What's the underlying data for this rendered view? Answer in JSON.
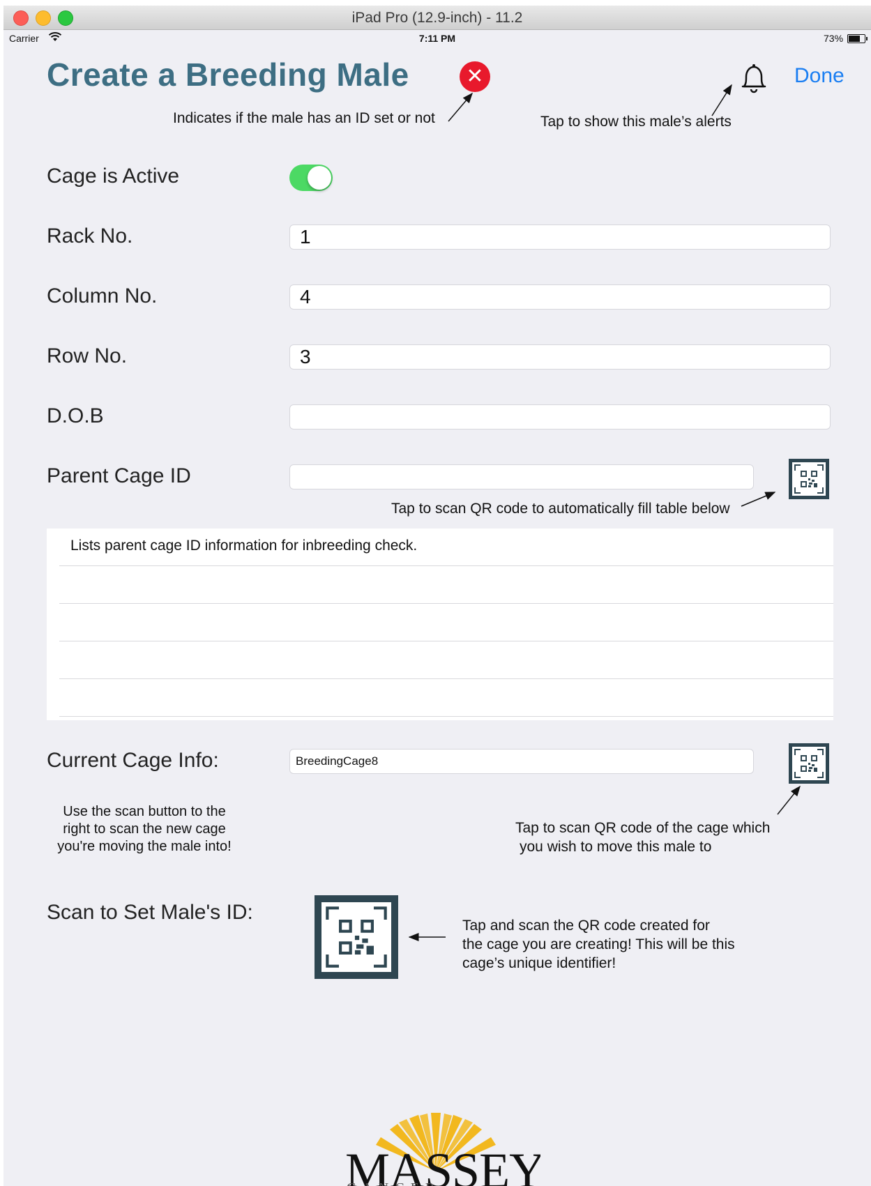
{
  "window": {
    "title": "iPad Pro (12.9-inch) - 11.2"
  },
  "status_bar": {
    "carrier": "Carrier",
    "time": "7:11 PM",
    "battery": "73%"
  },
  "header": {
    "title": "Create a Breeding Male",
    "id_status_glyph": "✕",
    "done_label": "Done",
    "id_status_color": "#e8192c",
    "accent_color": "#1a7ef2",
    "title_color": "#3d6e83"
  },
  "annotations": {
    "id_status": "Indicates if the male has an ID set or not",
    "alerts": "Tap to show this male’s alerts",
    "parent_scan": "Tap to scan QR code to automatically fill table below",
    "current_scan_line1": "Tap to scan QR code of the cage which",
    "current_scan_line2": "you wish to move this male to",
    "current_help_line1": "Use the scan button to the",
    "current_help_line2": "right to scan the new cage",
    "current_help_line3": "you're moving the male into!",
    "male_id_line1": "Tap and scan the QR code created for",
    "male_id_line2": "the cage you are creating! This will be this",
    "male_id_line3": "cage’s unique identifier!"
  },
  "form": {
    "cage_active": {
      "label": "Cage is Active",
      "on": true,
      "on_color": "#4cd964"
    },
    "rack": {
      "label": "Rack No.",
      "value": "1"
    },
    "column": {
      "label": "Column No.",
      "value": "4"
    },
    "row": {
      "label": "Row No.",
      "value": "3"
    },
    "dob": {
      "label": "D.O.B",
      "value": ""
    },
    "parent_cage": {
      "label": "Parent Cage ID",
      "value": ""
    },
    "current_cage": {
      "label": "Current Cage Info:",
      "value": "BreedingCage8"
    },
    "male_id": {
      "label": "Scan to Set Male's ID:"
    }
  },
  "parent_table": {
    "rows": [
      "Lists parent cage ID information for inbreeding check.",
      "",
      "",
      "",
      ""
    ]
  },
  "logo": {
    "word": "MASSEY",
    "subtitle": "CANCER CENTER"
  },
  "icons": {
    "status": "close-icon",
    "alerts": "bell-icon",
    "scan": "qr-code-icon",
    "wifi": "wifi-icon",
    "battery": "battery-icon"
  }
}
